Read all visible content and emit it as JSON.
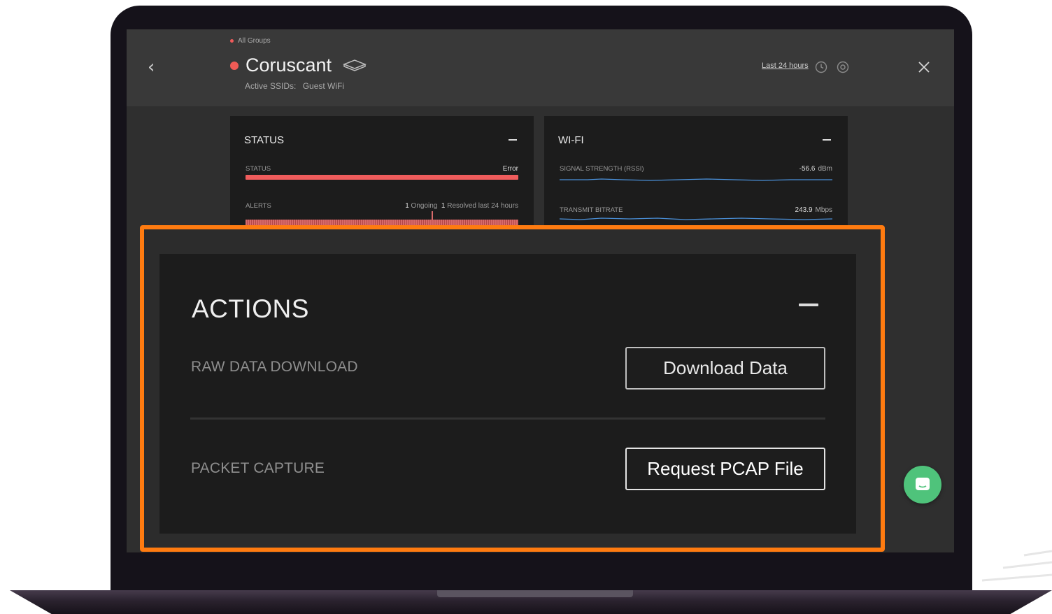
{
  "header": {
    "breadcrumb": "All Groups",
    "title": "Coruscant",
    "ssid_label": "Active SSIDs:",
    "ssid_value": "Guest WiFi",
    "time_range": "Last 24 hours",
    "status_color": "#f05b56",
    "icons": [
      "back-chevron-icon",
      "router-icon",
      "clock-icon",
      "settings-icon",
      "close-icon"
    ]
  },
  "status_card": {
    "title": "STATUS",
    "status_label": "STATUS",
    "status_value": "Error",
    "alerts_label": "ALERTS",
    "ongoing_count": "1",
    "ongoing_label": "Ongoing",
    "resolved_count": "1",
    "resolved_label": "Resolved last 24 hours",
    "error_color": "#ef5c5c"
  },
  "wifi_card": {
    "title": "WI-FI",
    "rssi_label": "SIGNAL STRENGTH (RSSI)",
    "rssi_value": "-56.6",
    "rssi_unit": "dBm",
    "bitrate_label": "TRANSMIT BITRATE",
    "bitrate_value": "243.9",
    "bitrate_unit": "Mbps",
    "line_color": "#4a90d9"
  },
  "actions": {
    "title": "ACTIONS",
    "raw_label": "RAW DATA DOWNLOAD",
    "download_button": "Download Data",
    "pcap_label": "PACKET CAPTURE",
    "pcap_button": "Request PCAP File",
    "highlight_color": "#ff7b10"
  },
  "chat": {
    "icon": "chat-bubble-icon",
    "color": "#4fc37b"
  }
}
